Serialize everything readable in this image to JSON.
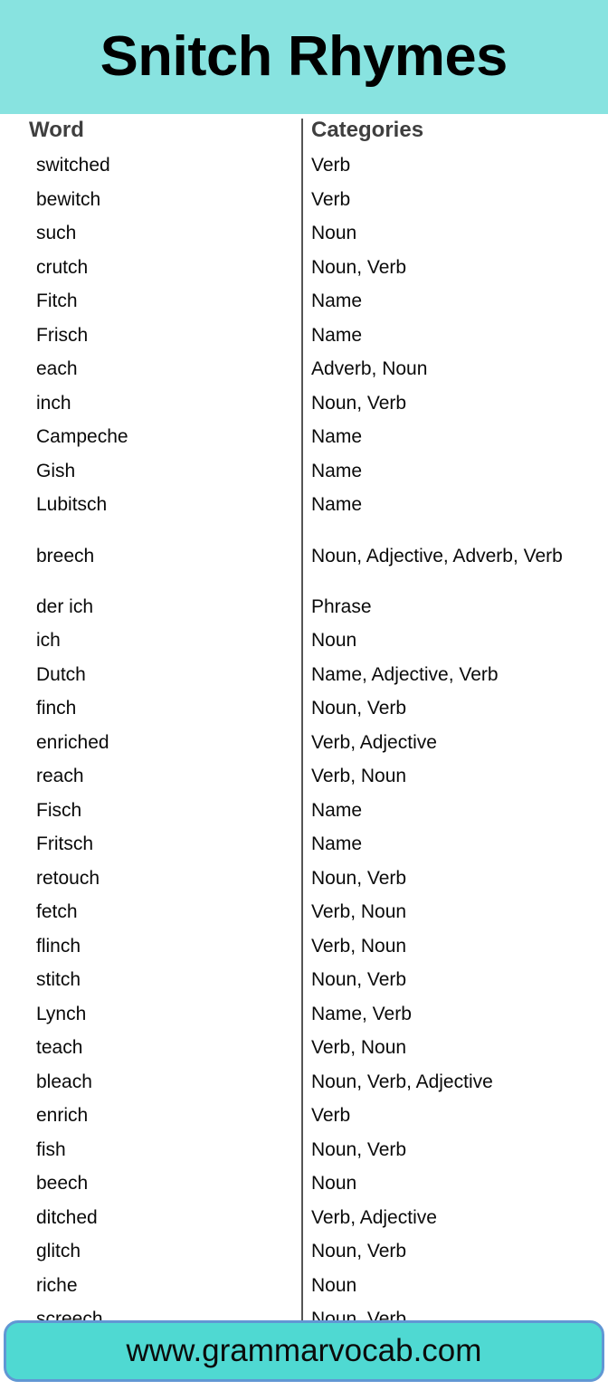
{
  "header": {
    "title": "Snitch Rhymes",
    "background_color": "#88e3e0"
  },
  "table": {
    "columns": {
      "word": "Word",
      "categories": "Categories"
    },
    "rows": [
      {
        "word": "switched",
        "categories": "Verb"
      },
      {
        "word": "bewitch",
        "categories": "Verb"
      },
      {
        "word": "such",
        "categories": "Noun"
      },
      {
        "word": "crutch",
        "categories": "Noun, Verb"
      },
      {
        "word": "Fitch",
        "categories": "Name"
      },
      {
        "word": "Frisch",
        "categories": "Name"
      },
      {
        "word": "each",
        "categories": "Adverb, Noun"
      },
      {
        "word": "inch",
        "categories": "Noun, Verb"
      },
      {
        "word": "Campeche",
        "categories": "Name"
      },
      {
        "word": "Gish",
        "categories": "Name"
      },
      {
        "word": "Lubitsch",
        "categories": "Name"
      },
      {
        "word": "breech",
        "categories": "Noun, Adjective, Adverb, Verb"
      },
      {
        "word": "der ich",
        "categories": "Phrase"
      },
      {
        "word": "ich",
        "categories": "Noun"
      },
      {
        "word": "Dutch",
        "categories": "Name, Adjective, Verb"
      },
      {
        "word": "finch",
        "categories": "Noun, Verb"
      },
      {
        "word": "enriched",
        "categories": "Verb, Adjective"
      },
      {
        "word": "reach",
        "categories": "Verb, Noun"
      },
      {
        "word": "Fisch",
        "categories": "Name"
      },
      {
        "word": "Fritsch",
        "categories": "Name"
      },
      {
        "word": "retouch",
        "categories": "Noun, Verb"
      },
      {
        "word": "fetch",
        "categories": "Verb, Noun"
      },
      {
        "word": "flinch",
        "categories": "Verb, Noun"
      },
      {
        "word": "stitch",
        "categories": "Noun, Verb"
      },
      {
        "word": "Lynch",
        "categories": "Name, Verb"
      },
      {
        "word": "teach",
        "categories": "Verb, Noun"
      },
      {
        "word": "bleach",
        "categories": "Noun, Verb, Adjective"
      },
      {
        "word": "enrich",
        "categories": "Verb"
      },
      {
        "word": "fish",
        "categories": "Noun, Verb"
      },
      {
        "word": "beech",
        "categories": "Noun"
      },
      {
        "word": "ditched",
        "categories": "Verb, Adjective"
      },
      {
        "word": "glitch",
        "categories": "Noun, Verb"
      },
      {
        "word": "riche",
        "categories": "Noun"
      },
      {
        "word": "screech",
        "categories": "Noun, Verb"
      }
    ]
  },
  "footer": {
    "url": "www.grammarvocab.com",
    "background_color": "#4fd9d2",
    "border_color": "#6197d4"
  }
}
